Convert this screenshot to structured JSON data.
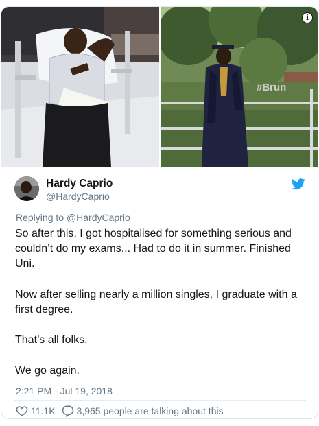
{
  "author": {
    "display_name": "Hardy Caprio",
    "handle": "@HardyCaprio"
  },
  "reply_context": {
    "prefix": "Replying to ",
    "mention": "@HardyCaprio"
  },
  "tweet": {
    "text": "So after this, I got hospitalised for something serious and couldn’t do my exams... Had to do it in summer. Finished Uni.\n\nNow after selling nearly a million singles, I graduate with a first degree.\n\nThat’s all folks.\n\nWe go again.",
    "timestamp": "2:21 PM - Jul 19, 2018"
  },
  "engagement": {
    "likes": "11.1K",
    "talking": "3,965 people are talking about this"
  },
  "media": {
    "info_glyph": "i",
    "photo_left_icon": "hospital-bed-photo",
    "photo_right_icon": "graduation-photo"
  },
  "colors": {
    "twitter_blue": "#1da1f2",
    "muted_text": "#657786",
    "border": "#e1e8ed"
  }
}
